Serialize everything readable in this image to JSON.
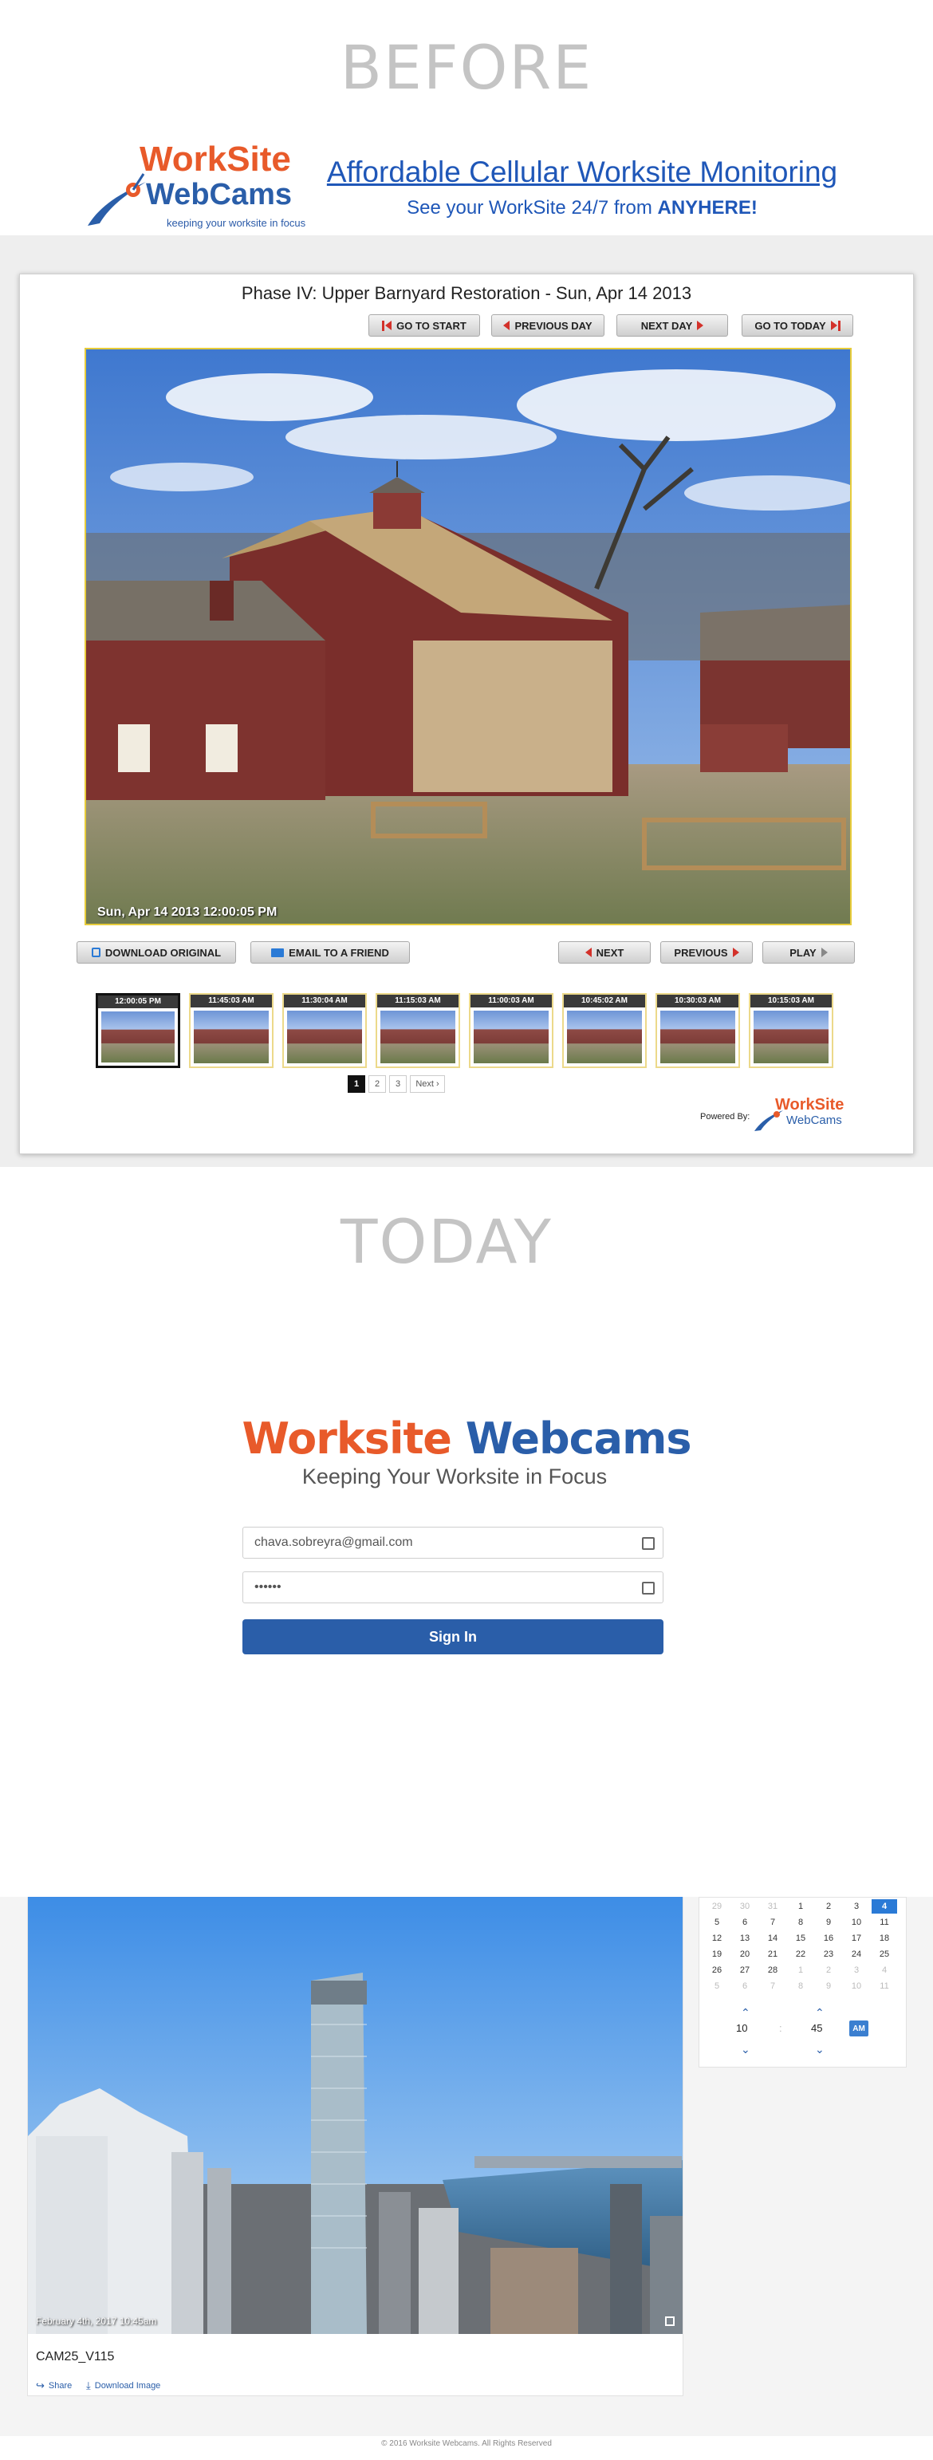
{
  "before": {
    "heading": "BEFORE",
    "logo": {
      "line1": "WorkSite",
      "line2": "WebCams",
      "tagline": "keeping your worksite in focus"
    },
    "headline": "Affordable Cellular Worksite Monitoring",
    "subline_prefix": "See your WorkSite 24/7 from ",
    "subline_bold": "ANYHERE!",
    "viewer": {
      "title": "Phase IV: Upper Barnyard Restoration - Sun, Apr 14 2013",
      "nav": {
        "go_to_start": "GO TO START",
        "previous_day": "PREVIOUS DAY",
        "next_day": "NEXT DAY",
        "go_to_today": "GO TO TODAY"
      },
      "timestamp": "Sun, Apr 14 2013 12:00:05 PM",
      "actions": {
        "download": "DOWNLOAD ORIGINAL",
        "email": "EMAIL TO A FRIEND",
        "next": "NEXT",
        "previous": "PREVIOUS",
        "play": "PLAY"
      },
      "thumbnails": [
        "12:00:05 PM",
        "11:45:03 AM",
        "11:30:04 AM",
        "11:15:03 AM",
        "11:00:03 AM",
        "10:45:02 AM",
        "10:30:03 AM",
        "10:15:03 AM"
      ],
      "pagination": {
        "pages": [
          "1",
          "2",
          "3"
        ],
        "next": "Next ›",
        "current": "1"
      },
      "powered_by": "Powered By:",
      "mini_logo": {
        "line1": "WorkSite",
        "line2": "WebCams"
      }
    }
  },
  "today": {
    "heading": "TODAY",
    "brand": {
      "word1": "Worksite",
      "word2": "Webcams",
      "tagline": "Keeping Your Worksite in Focus"
    },
    "login": {
      "email": "chava.sobreyra@gmail.com",
      "password": "••••••",
      "submit": "Sign In"
    },
    "camera": {
      "timestamp": "February 4th, 2017 10:45am",
      "name": "CAM25_V115",
      "share": "Share",
      "download": "Download Image"
    },
    "calendar": {
      "rows": [
        [
          "29",
          "30",
          "31",
          "1",
          "2",
          "3",
          "4"
        ],
        [
          "5",
          "6",
          "7",
          "8",
          "9",
          "10",
          "11"
        ],
        [
          "12",
          "13",
          "14",
          "15",
          "16",
          "17",
          "18"
        ],
        [
          "19",
          "20",
          "21",
          "22",
          "23",
          "24",
          "25"
        ],
        [
          "26",
          "27",
          "28",
          "1",
          "2",
          "3",
          "4"
        ],
        [
          "5",
          "6",
          "7",
          "8",
          "9",
          "10",
          "11"
        ]
      ],
      "selected": "4",
      "hour": "10",
      "minute": "45",
      "separator": ":",
      "period": "AM"
    },
    "footer": "© 2016 Worksite Webcams. All Rights Reserved"
  },
  "colors": {
    "orange": "#e85a2a",
    "blue": "#2a5ea9",
    "heading_gray": "#c4c4c4",
    "link_blue": "#1f57b8"
  }
}
